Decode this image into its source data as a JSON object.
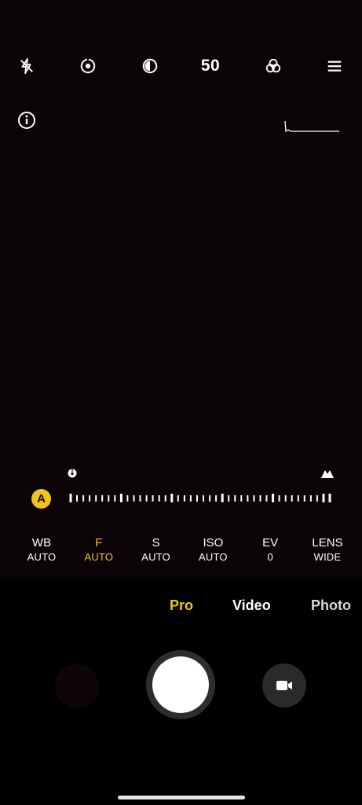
{
  "top_bar": {
    "items": [
      {
        "icon": "flash-off-icon"
      },
      {
        "icon": "live-photo-icon"
      },
      {
        "icon": "contrast-icon"
      },
      {
        "label": "50"
      },
      {
        "icon": "filters-icon"
      },
      {
        "icon": "menu-icon"
      }
    ]
  },
  "viewfinder": {
    "info_icon": "info-icon",
    "histogram_icon": "histogram-graph"
  },
  "focus": {
    "near_icon": "macro-flower-icon",
    "far_icon": "mountain-icon",
    "mode_badge": "A"
  },
  "params": [
    {
      "name": "WB",
      "value": "AUTO",
      "active": false
    },
    {
      "name": "F",
      "value": "AUTO",
      "active": true
    },
    {
      "name": "S",
      "value": "AUTO",
      "active": false
    },
    {
      "name": "ISO",
      "value": "AUTO",
      "active": false
    },
    {
      "name": "EV",
      "value": "0",
      "active": false
    },
    {
      "name": "LENS",
      "value": "WIDE",
      "active": false
    }
  ],
  "modes": [
    {
      "label": "Pro",
      "active": true
    },
    {
      "label": "Video",
      "active": false
    },
    {
      "label": "Photo",
      "active": false
    }
  ],
  "colors": {
    "accent": "#f4c21b",
    "background": "#000000",
    "viewfinder": "#0b0407"
  }
}
